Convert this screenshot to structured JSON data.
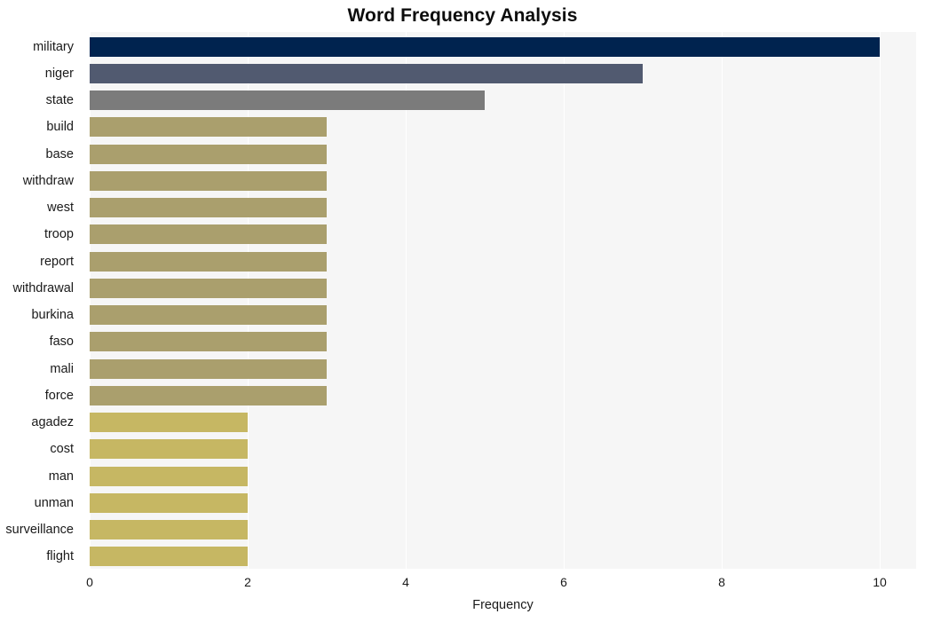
{
  "chart_data": {
    "type": "bar",
    "orientation": "horizontal",
    "title": "Word Frequency Analysis",
    "xlabel": "Frequency",
    "ylabel": "",
    "xlim": [
      0,
      10.46
    ],
    "xticks": [
      0,
      2,
      4,
      6,
      8,
      10
    ],
    "xtick_labels": [
      "0",
      "2",
      "4",
      "6",
      "8",
      "10"
    ],
    "grid": true,
    "grid_axis": "x",
    "legend": null,
    "plot_background": "#f6f6f6",
    "figure_background": "#ffffff",
    "gridline_color": "#ffffff",
    "categories": [
      "military",
      "niger",
      "state",
      "build",
      "base",
      "withdraw",
      "west",
      "troop",
      "report",
      "withdrawal",
      "burkina",
      "faso",
      "mali",
      "force",
      "agadez",
      "cost",
      "man",
      "unman",
      "surveillance",
      "flight"
    ],
    "values": [
      10,
      7,
      5,
      3,
      3,
      3,
      3,
      3,
      3,
      3,
      3,
      3,
      3,
      3,
      2,
      2,
      2,
      2,
      2,
      2
    ],
    "bar_colors": [
      "#00234f",
      "#515a70",
      "#7b7b7b",
      "#aa9f6d",
      "#aa9f6d",
      "#aa9f6d",
      "#aa9f6d",
      "#aa9f6d",
      "#aa9f6d",
      "#aa9f6d",
      "#aa9f6d",
      "#aa9f6d",
      "#aa9f6d",
      "#aa9f6d",
      "#c6b763",
      "#c6b763",
      "#c6b763",
      "#c6b763",
      "#c6b763",
      "#c6b763"
    ]
  }
}
